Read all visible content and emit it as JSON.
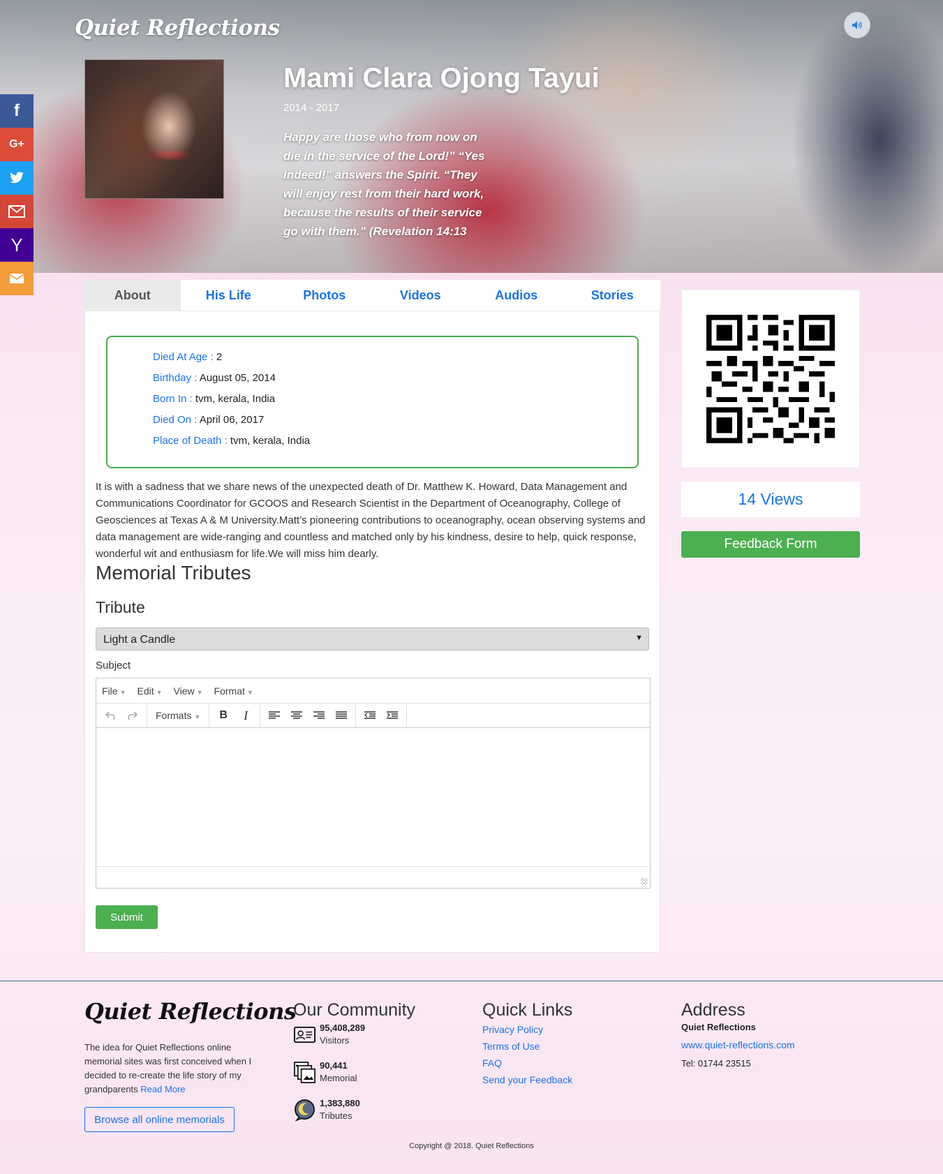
{
  "header": {
    "logo": "Quiet Reflections",
    "name": "Mami Clara Ojong Tayui",
    "years": "2014 - 2017",
    "quote": "Happy are those who from now on die in the service of the Lord!” “Yes indeed!” answers the Spirit. “They will enjoy rest from their hard work, because the results of their service go with them.” (Revelation 14:13"
  },
  "social": [
    {
      "name": "facebook",
      "glyph": "f",
      "color": "#3b5998"
    },
    {
      "name": "google-plus",
      "glyph": "G+",
      "color": "#dd4b39"
    },
    {
      "name": "twitter",
      "glyph": "🐦",
      "color": "#1da1f2"
    },
    {
      "name": "gmail",
      "glyph": "M",
      "color": "#d44638"
    },
    {
      "name": "yahoo",
      "glyph": "Y",
      "color": "#410093"
    },
    {
      "name": "email",
      "glyph": "✉",
      "color": "#f39c3c"
    }
  ],
  "tabs": [
    "About",
    "His Life",
    "Photos",
    "Videos",
    "Audios",
    "Stories"
  ],
  "info": {
    "age_key": "Died At Age : ",
    "age_val": "2",
    "birthday_key": "Birthday : ",
    "birthday_val": "August 05, 2014",
    "born_key": "Born In : ",
    "born_val": "tvm, kerala, India",
    "died_key": "Died On : ",
    "died_val": "April 06, 2017",
    "place_key": "Place of Death : ",
    "place_val": "tvm, kerala, India"
  },
  "bio": "It is with a sadness that we share news of the unexpected death of Dr. Matthew K. Howard, Data Management and Communications Coordinator for GCOOS and Research Scientist in the Department of Oceanography, College of Geosciences at Texas A & M University.Matt’s pioneering contributions to oceanography, ocean observing systems and data management are wide-ranging and countless and matched only by his kindness, desire to help, quick response, wonderful wit and enthusiasm for life.We will miss him dearly.",
  "tributes": {
    "heading": "Memorial Tributes",
    "tribute_label": "Tribute",
    "select_value": "Light a Candle",
    "subject_label": "Subject",
    "menus": [
      "File",
      "Edit",
      "View",
      "Format"
    ],
    "formats_label": "Formats",
    "submit": "Submit"
  },
  "sidebar": {
    "views": "14 Views",
    "feedback": "Feedback Form"
  },
  "footer": {
    "logo": "Quiet Reflections",
    "about": "The idea for Quiet Reflections online memorial sites was first conceived when I decided to re-create the life story of my grandparents",
    "read_more": "Read More",
    "browse": "Browse all online memorials",
    "community_heading": "Our Community",
    "stats": [
      {
        "num": "95,408,289",
        "label": "Visitors"
      },
      {
        "num": "90,441",
        "label": "Memorial"
      },
      {
        "num": "1,383,880",
        "label": "Tributes"
      }
    ],
    "quick_heading": "Quick Links",
    "links": [
      "Privacy Policy",
      "Terms of Use",
      "FAQ",
      "Send your Feedback"
    ],
    "address_heading": "Address",
    "company": "Quiet Reflections",
    "website": "www.quiet-reflections.com",
    "tel": "Tel: 01744 23515",
    "copyright": "Copyright @ 2018. Quiet Reflections"
  }
}
